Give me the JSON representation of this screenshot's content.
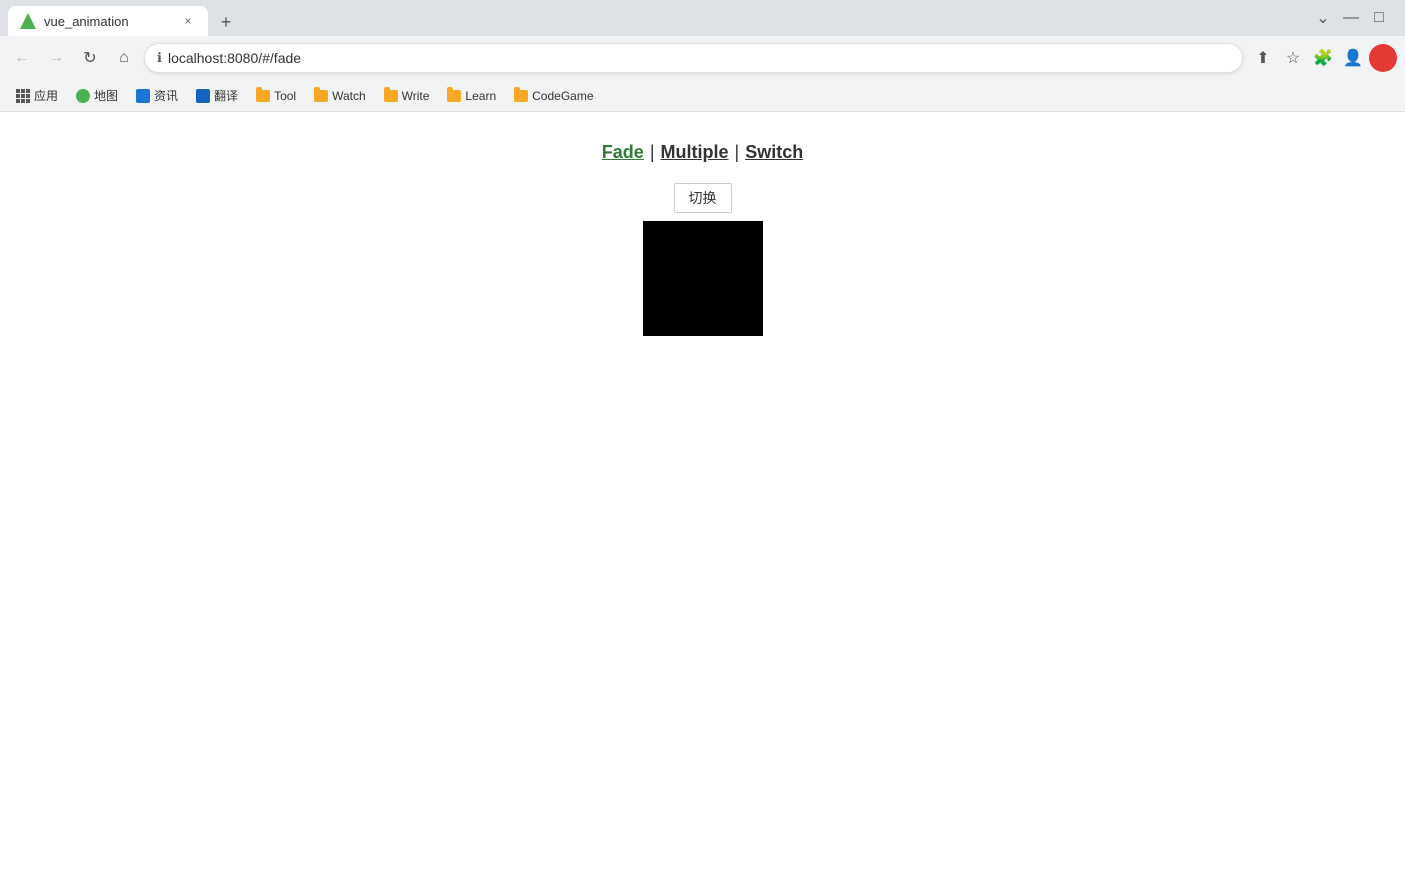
{
  "window": {
    "title": "vue_animation",
    "url": "localhost:8080/#/fade"
  },
  "titlebar": {
    "tab_title": "vue_animation",
    "close_label": "×",
    "new_tab_label": "+",
    "minimize": "—",
    "maximize": "□",
    "tab_list": "⌄"
  },
  "navbar": {
    "back": "←",
    "forward": "→",
    "refresh": "↻",
    "home": "⌂",
    "address": "localhost:8080/#/fade",
    "lock_icon": "🔒"
  },
  "bookmarks": {
    "items": [
      {
        "label": "应用",
        "type": "apps"
      },
      {
        "label": "地图",
        "color": "#4caf50"
      },
      {
        "label": "资讯",
        "color": "#1976d2"
      },
      {
        "label": "翻译",
        "color": "#1565c0"
      },
      {
        "label": "Tool",
        "color": "#f9a825"
      },
      {
        "label": "Watch",
        "color": "#f9a825"
      },
      {
        "label": "Write",
        "color": "#f9a825"
      },
      {
        "label": "Learn",
        "color": "#f9a825"
      },
      {
        "label": "CodeGame",
        "color": "#f9a825"
      }
    ]
  },
  "page": {
    "nav": {
      "fade_label": "Fade",
      "multiple_label": "Multiple",
      "switch_label": "Switch",
      "sep1": "|",
      "sep2": "|"
    },
    "button_label": "切换",
    "box_color": "#000000"
  }
}
